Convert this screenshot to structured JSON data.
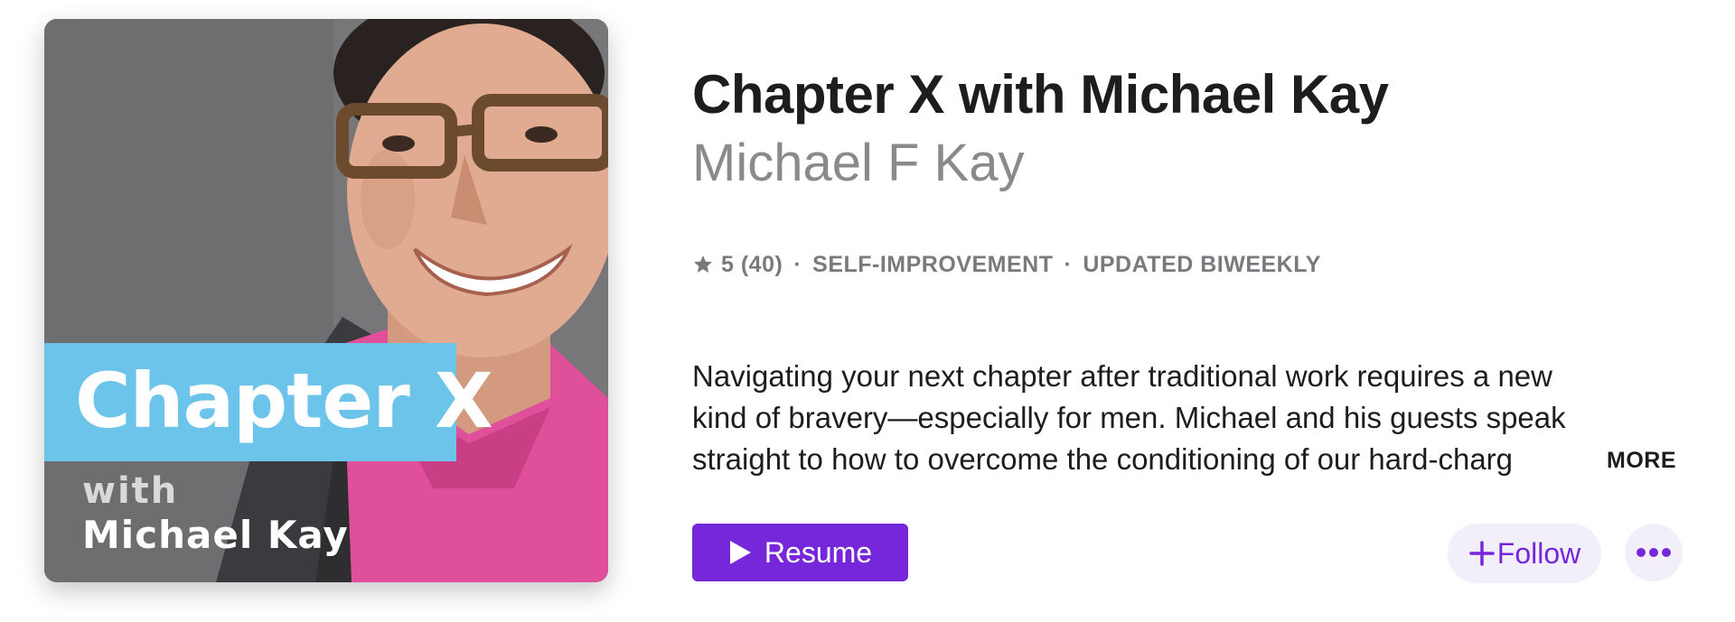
{
  "artwork": {
    "title_text": "Chapter X",
    "with_text": "with",
    "name_text": "Michael Kay"
  },
  "podcast": {
    "title": "Chapter X with Michael Kay",
    "author": "Michael F Kay"
  },
  "meta": {
    "star_icon": "star-icon",
    "rating_text": "5 (40)",
    "separator": "·",
    "category": "SELF-IMPROVEMENT",
    "frequency": "UPDATED BIWEEKLY"
  },
  "description": {
    "text": "Navigating your next chapter after traditional work requires a new kind of bravery—especially for men. Michael and his guests speak straight to how to overcome the conditioning of our hard-charg",
    "more_label": "MORE"
  },
  "actions": {
    "resume_label": "Resume",
    "follow_label": "Follow",
    "play_icon": "play-icon",
    "plus_icon": "plus-icon",
    "ellipsis_icon": "ellipsis-icon"
  },
  "colors": {
    "accent": "#7527d9",
    "accent_tint": "#f3effa",
    "artwork_band": "#6cc4ea",
    "text_primary": "#1d1d1f",
    "text_secondary": "#8a8a8d"
  }
}
